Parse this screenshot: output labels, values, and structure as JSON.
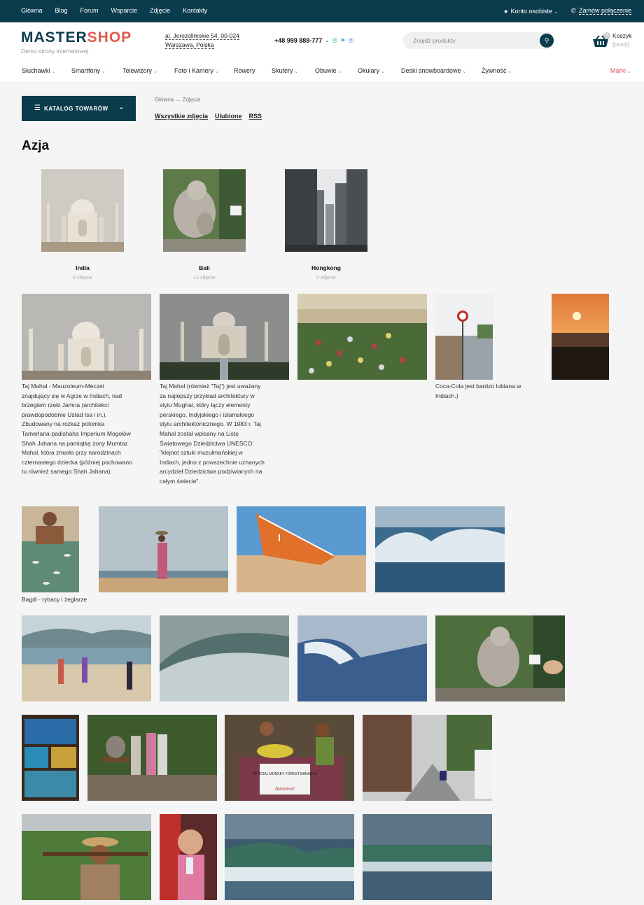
{
  "topbar": {
    "nav": [
      "Główna",
      "Blog",
      "Forum",
      "Wsparcie",
      "Zdjęcie",
      "Kontakty"
    ],
    "account": "Konto osobiste",
    "callback": "Zamów połączenie"
  },
  "header": {
    "logo_a": "MASTER",
    "logo_b": "SHOP",
    "logo_sub": "Demo strony internetowej",
    "address_line1": "al. Jerozolimskie 54, 00-024",
    "address_line2": "Warszawa, Polska",
    "phone": "+48 999 888-777",
    "search_placeholder": "Znajdź produkty",
    "cart_label": "Koszyk",
    "cart_empty": "(pusty)",
    "cart_count": "0"
  },
  "catnav": [
    "Słuchawki",
    "Smartfony",
    "Telewizory",
    "Foto i Kamery",
    "Rowery",
    "Skutery",
    "Obuwie",
    "Okulary",
    "Deski snowboardowe",
    "Żywność"
  ],
  "catnav_brands": "Marki",
  "catalog_button": "KATALOG TOWARÓW",
  "breadcrumb": {
    "home": "Główna",
    "sep": "→",
    "current": "Zdjęcia"
  },
  "subtabs": [
    "Wszystkie zdjęcia",
    "Ulubione",
    "RSS"
  ],
  "page_title": "Azja",
  "albums": [
    {
      "name": "India",
      "count": "0 zdjęcie"
    },
    {
      "name": "Bali",
      "count": "13 zdjęcie"
    },
    {
      "name": "Hongkong",
      "count": "0 zdjęcie"
    }
  ],
  "captions": {
    "taj1": "Taj Mahal - Mauzoleum-Meczet znajdujący się w Agrze w Indiach, nad brzegiem rzeki Jamna (architekci prawdopodobnie Ustad Isa i in.). Zbudowany na rozkaz potomka Tamerlana-padishaha Imperium Mogołów Shah Jahana na pamiątkę żony Mumtaz Mahal, która zmarła przy narodzinach czternastego dziecka (później pochowano tu również samego Shah Jahana).",
    "taj2": "Taj Mahal (również \"Taj\") jest uważany za najlepszy przykład architektury w stylu Mughal, który łączy elementy perskiego, Indyjskiego i islamskiego stylu architektonicznego. W 1983 r. Taj Mahal został wpisany na Listę Światowego Dziedzictwa UNESCO: \"klejnot sztuki muzułmańskiej w Indiach, jedno z powszechnie uznanych arcydzieł Dziedzictwa podziwianych na całym świecie\".",
    "cocacola": "Coca-Cola jest bardzo lubiana w Indiach.)",
    "bagdi": "Bagdi - rybacy i żeglarze"
  },
  "sign_text": {
    "boat": "OFFICIAL MONKEY FOREST BANANAS",
    "attention": "Attention!"
  }
}
